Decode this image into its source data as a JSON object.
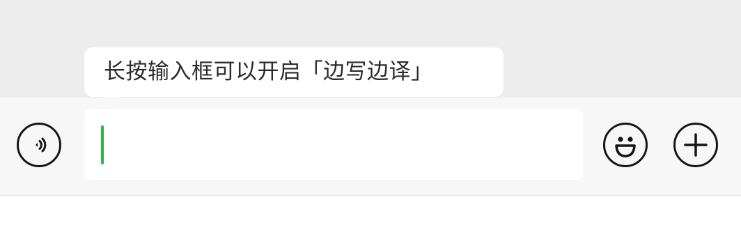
{
  "tooltip": {
    "text": "长按输入框可以开启「边写边译」"
  },
  "input": {
    "value": ""
  },
  "buttons": {
    "voice_icon": "voice-input-icon",
    "emoji_icon": "emoji-face-icon",
    "plus_icon": "plus-more-icon"
  },
  "colors": {
    "caret": "#2fb24e",
    "icon_stroke": "#161616",
    "background": "#ededed",
    "input_bar": "#f7f7f7"
  }
}
